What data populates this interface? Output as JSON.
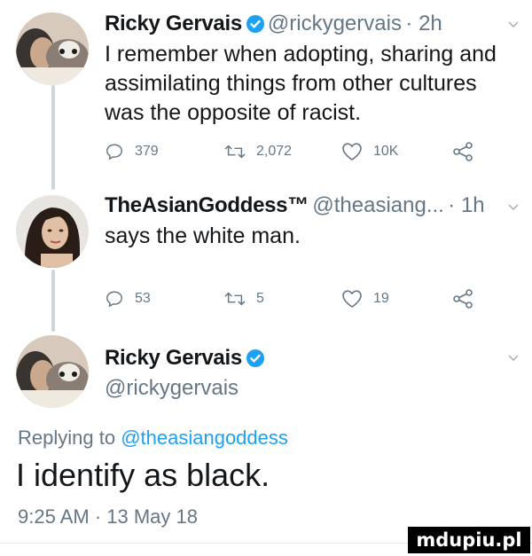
{
  "tweet1": {
    "name": "Ricky Gervais",
    "handle": "@rickygervais",
    "time": "· 2h",
    "text_lines": [
      "I remember when adopting, sharing and",
      "assimilating things from other cultures",
      "was the opposite of racist."
    ],
    "replies": "379",
    "retweets": "2,072",
    "likes": "10K"
  },
  "tweet2": {
    "name": "TheAsianGoddess™",
    "handle": "@theasiang...",
    "time": "· 1h",
    "text": "says the white man.",
    "replies": "53",
    "retweets": "5",
    "likes": "19"
  },
  "tweet3": {
    "name": "Ricky Gervais",
    "handle": "@rickygervais",
    "replying_prefix": "Replying to",
    "replying_handle": "@theasiangoddess",
    "text": "I identify as black.",
    "timestamp": "9:25 AM · 13 May 18"
  },
  "watermark": "mdupiu.pl",
  "colors": {
    "verified": "#1da1f2",
    "link": "#1da1f2",
    "secondary": "#657786",
    "thread_line": "#ccd6dd"
  }
}
